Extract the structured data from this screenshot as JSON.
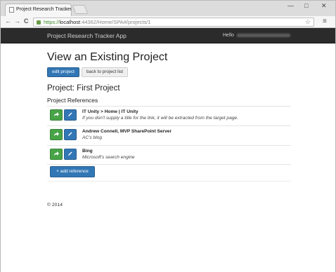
{
  "browser": {
    "tab_title": "Project Research Tracker",
    "tab_close": "×",
    "url_scheme": "https://",
    "url_host": "localhost",
    "url_path": ":44362/Home/SPA#/projects/1",
    "back": "←",
    "forward": "→",
    "reload": "C",
    "star": "☆",
    "menu": "≡",
    "minimize": "—",
    "maximize": "□",
    "close": "✕"
  },
  "navbar": {
    "brand": "Project Research Tracker App",
    "hello": "Hello"
  },
  "page": {
    "heading": "View an Existing Project",
    "edit_button": "edit project",
    "back_button": "back to project list",
    "project_heading": "Project: First Project",
    "references_heading": "Project References",
    "add_button": "+ add reference",
    "footer": "© 2014"
  },
  "references": [
    {
      "title": "IT Unity > Home | IT Unity",
      "description": "If you don't supply a title for the link, it will be extracted from the target page."
    },
    {
      "title": "Andrew Connell, MVP SharePoint Server",
      "description": "AC's blog"
    },
    {
      "title": "Bing",
      "description": "Microsoft's search engine"
    }
  ],
  "icons": {
    "go": "share-arrow-icon",
    "edit": "pencil-icon",
    "add": "plus-icon"
  },
  "colors": {
    "primary": "#3277b5",
    "success": "#47a447",
    "navbar": "#2b2b2b"
  }
}
